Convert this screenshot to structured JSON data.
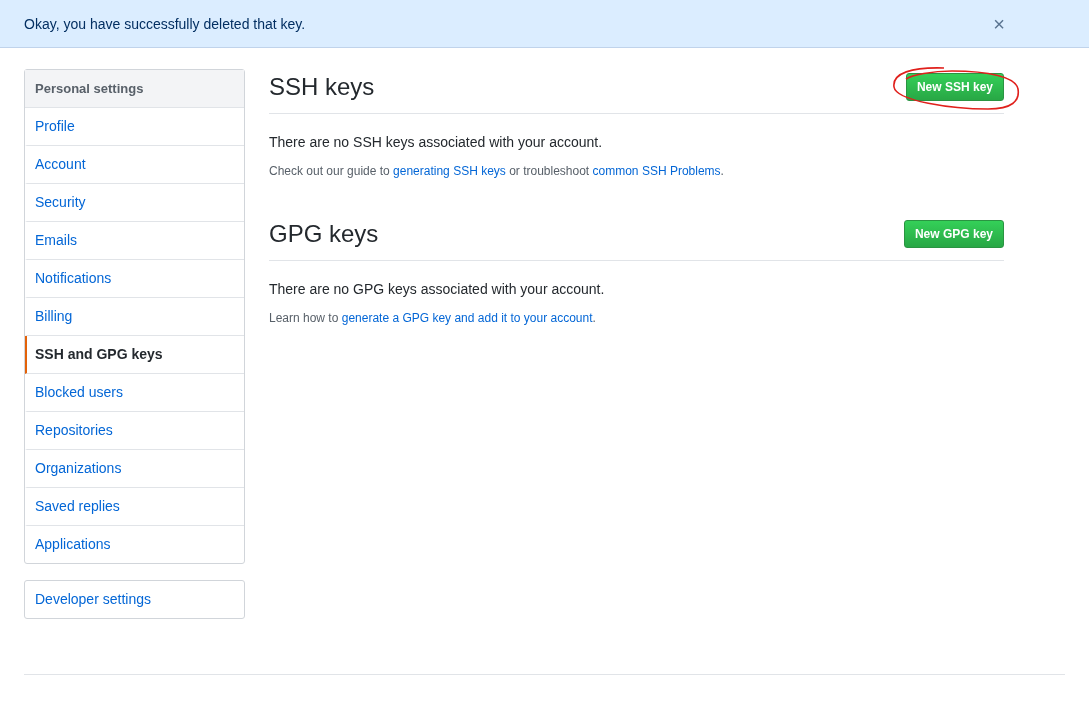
{
  "flash": {
    "message": "Okay, you have successfully deleted that key.",
    "close": "×"
  },
  "sidebar": {
    "heading": "Personal settings",
    "items": [
      {
        "label": "Profile",
        "selected": false
      },
      {
        "label": "Account",
        "selected": false
      },
      {
        "label": "Security",
        "selected": false
      },
      {
        "label": "Emails",
        "selected": false
      },
      {
        "label": "Notifications",
        "selected": false
      },
      {
        "label": "Billing",
        "selected": false
      },
      {
        "label": "SSH and GPG keys",
        "selected": true
      },
      {
        "label": "Blocked users",
        "selected": false
      },
      {
        "label": "Repositories",
        "selected": false
      },
      {
        "label": "Organizations",
        "selected": false
      },
      {
        "label": "Saved replies",
        "selected": false
      },
      {
        "label": "Applications",
        "selected": false
      }
    ]
  },
  "developer_settings": "Developer settings",
  "sections": [
    {
      "title": "SSH keys",
      "button": "New SSH key",
      "annotated": true,
      "empty": "There are no SSH keys associated with your account.",
      "help": [
        {
          "text": "Check out our guide to ",
          "kind": "text"
        },
        {
          "text": "generating SSH keys",
          "kind": "link"
        },
        {
          "text": " or troubleshoot ",
          "kind": "text"
        },
        {
          "text": "common SSH Problems",
          "kind": "link"
        },
        {
          "text": ".",
          "kind": "text"
        }
      ]
    },
    {
      "title": "GPG keys",
      "button": "New GPG key",
      "annotated": false,
      "empty": "There are no GPG keys associated with your account.",
      "help": [
        {
          "text": "Learn how to ",
          "kind": "text"
        },
        {
          "text": "generate a GPG key and add it to your account",
          "kind": "link"
        },
        {
          "text": ".",
          "kind": "text"
        }
      ]
    }
  ]
}
